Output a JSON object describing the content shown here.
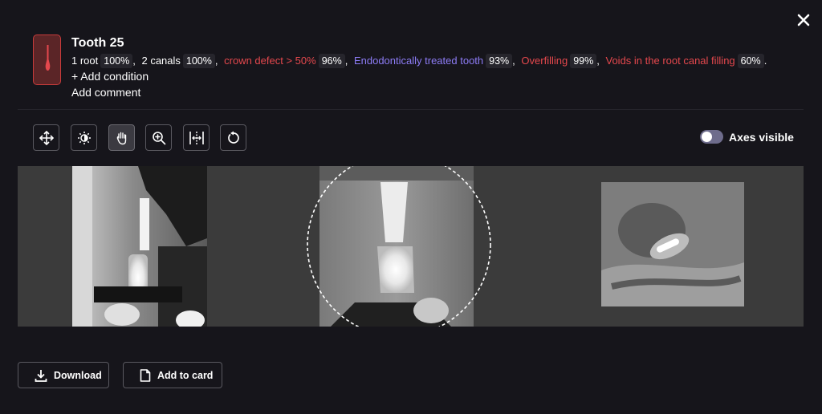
{
  "tooth": {
    "title": "Tooth 25",
    "conditions": [
      {
        "label": "1 root",
        "pct": "100%",
        "color": "#ffffff"
      },
      {
        "label": "2 canals",
        "pct": "100%",
        "color": "#ffffff"
      },
      {
        "label": "crown defect > 50%",
        "pct": "96%",
        "color": "#e5484d"
      },
      {
        "label": "Endodontically treated tooth",
        "pct": "93%",
        "color": "#8d7cf6"
      },
      {
        "label": "Overfilling",
        "pct": "99%",
        "color": "#e5484d"
      },
      {
        "label": "Voids in the root canal filling",
        "pct": "60%",
        "color": "#e5484d"
      }
    ],
    "add_condition": "+ Add condition",
    "add_comment": "Add comment"
  },
  "toolbar": {
    "tools": [
      "move-icon",
      "brightness-icon",
      "hand-icon",
      "zoom-icon",
      "split-icon",
      "reset-icon"
    ],
    "active_tool": "hand-icon",
    "axes_label": "Axes visible"
  },
  "actions": {
    "download_label": "Download",
    "add_to_card_label": "Add to card"
  },
  "colors": {
    "background": "#16151b",
    "danger": "#e5484d",
    "accent": "#8d7cf6"
  }
}
